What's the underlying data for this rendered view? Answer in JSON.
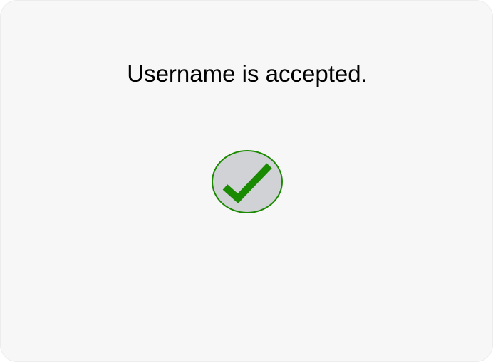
{
  "dialog": {
    "message": "Username is accepted.",
    "status_icon": "checkmark-success-icon",
    "colors": {
      "background": "#f7f7f7",
      "check_green": "#1a8a00",
      "circle_fill": "#d0d2d6",
      "divider": "#8b8b8b"
    }
  }
}
